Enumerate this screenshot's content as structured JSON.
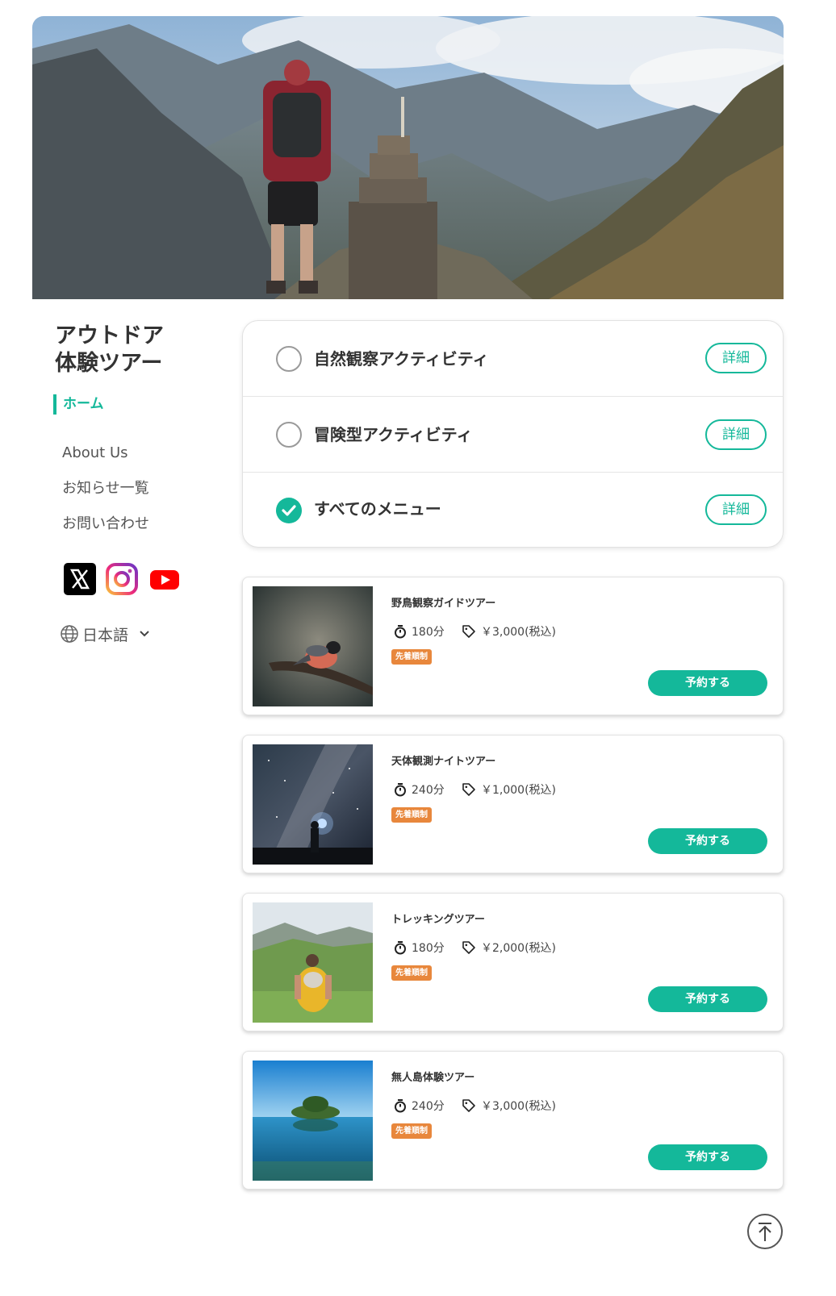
{
  "site": {
    "title_line1": "アウトドア",
    "title_line2": "体験ツアー"
  },
  "nav": {
    "home": "ホーム",
    "items": [
      "About Us",
      "お知らせ一覧",
      "お問い合わせ"
    ]
  },
  "social": [
    "x-icon",
    "instagram-icon",
    "youtube-icon"
  ],
  "language": {
    "label": "日本語",
    "icon": "globe-icon"
  },
  "categories": [
    {
      "label": "自然観察アクティビティ",
      "selected": false,
      "detail_label": "詳細"
    },
    {
      "label": "冒険型アクティビティ",
      "selected": false,
      "detail_label": "詳細"
    },
    {
      "label": "すべてのメニュー",
      "selected": true,
      "detail_label": "詳細"
    }
  ],
  "tours": [
    {
      "name": "野鳥観察ガイドツアー",
      "duration": "180分",
      "price": "￥3,000(税込)",
      "badge": "先着順制",
      "reserve_label": "予約する",
      "image": "bird-photo"
    },
    {
      "name": "天体観測ナイトツアー",
      "duration": "240分",
      "price": "￥1,000(税込)",
      "badge": "先着順制",
      "reserve_label": "予約する",
      "image": "night-sky-photo"
    },
    {
      "name": "トレッキングツアー",
      "duration": "180分",
      "price": "￥2,000(税込)",
      "badge": "先着順制",
      "reserve_label": "予約する",
      "image": "trekking-photo"
    },
    {
      "name": "無人島体験ツアー",
      "duration": "240分",
      "price": "￥3,000(税込)",
      "badge": "先着順制",
      "reserve_label": "予約する",
      "image": "island-photo"
    }
  ],
  "colors": {
    "accent": "#14b89a",
    "badge": "#e8873c",
    "text": "#333333"
  }
}
